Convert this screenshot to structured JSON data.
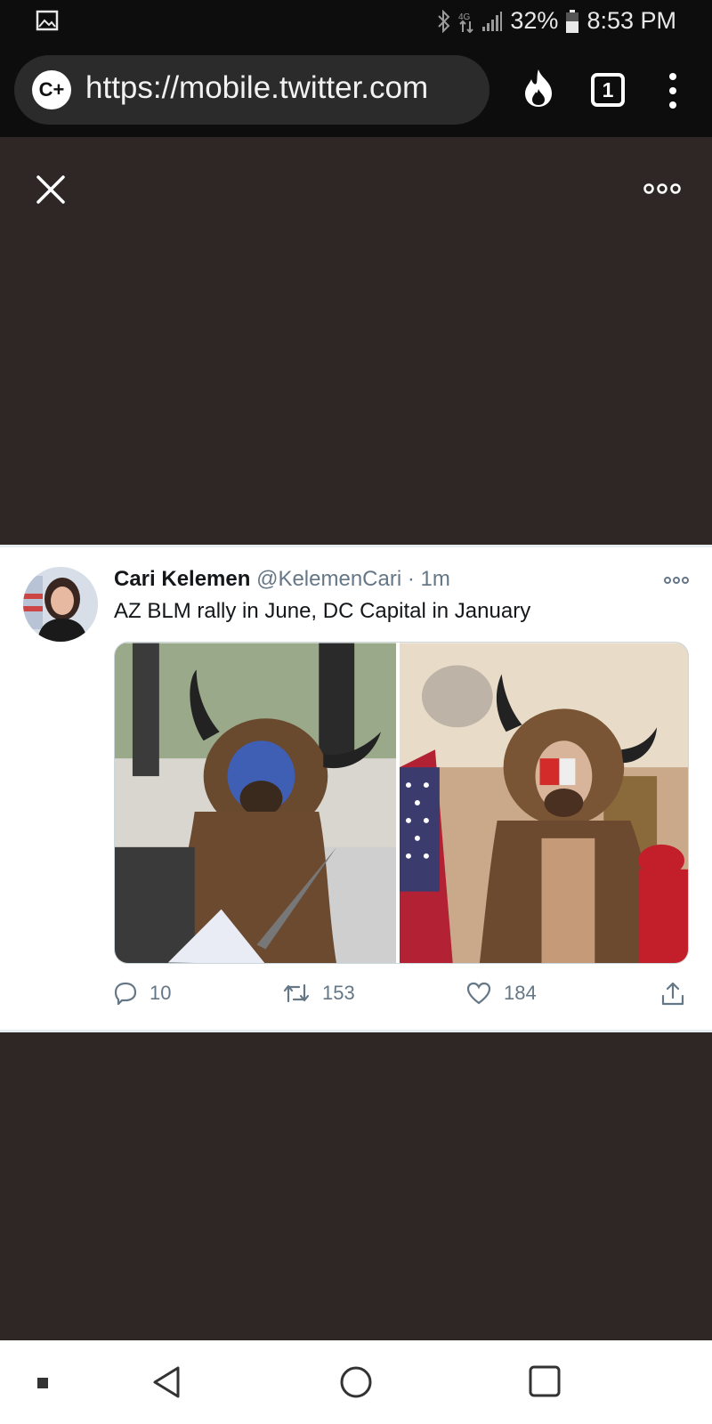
{
  "status_bar": {
    "battery": "32%",
    "time": "8:53 PM",
    "network": "4G"
  },
  "browser": {
    "url": "https://mobile.twitter.com",
    "tab_count": "1",
    "logo_text": "C+"
  },
  "tweet": {
    "name": "Cari Kelemen",
    "handle": "@KelemenCari",
    "separator": "·",
    "time": "1m",
    "text": "AZ BLM rally in June, DC Capital in January",
    "replies": "10",
    "retweets": "153",
    "likes": "184"
  },
  "icons": {
    "status": [
      "image-icon",
      "bluetooth-icon",
      "data-arrows-icon",
      "signal-icon",
      "battery-icon"
    ],
    "browser": [
      "cplus-logo-icon",
      "fire-icon",
      "tabs-icon",
      "kebab-menu-icon"
    ],
    "overlay": [
      "close-icon",
      "more-icon"
    ],
    "actions": [
      "reply-icon",
      "retweet-icon",
      "like-icon",
      "share-icon"
    ],
    "nav": [
      "nav-square-small-icon",
      "back-icon",
      "home-icon",
      "recents-icon"
    ]
  },
  "colors": {
    "overlay": "#2e2726",
    "status_bar": "#0d0d0d",
    "url_pill": "#2b2b2b",
    "tweet_text": "#14171a",
    "secondary_text": "#657786"
  }
}
